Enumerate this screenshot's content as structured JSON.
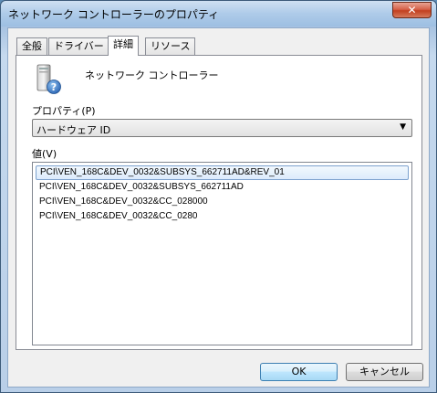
{
  "window": {
    "title": "ネットワーク コントローラーのプロパティ",
    "close_label": "✕"
  },
  "tabs": [
    {
      "label": "全般"
    },
    {
      "label": "ドライバー"
    },
    {
      "label": "詳細"
    },
    {
      "label": "リソース"
    }
  ],
  "device": {
    "name": "ネットワーク コントローラー",
    "icon": "unknown-device-icon"
  },
  "property": {
    "label": "プロパティ(P)",
    "selected": "ハードウェア ID"
  },
  "values": {
    "label": "値(V)",
    "items": [
      "PCI\\VEN_168C&DEV_0032&SUBSYS_662711AD&REV_01",
      "PCI\\VEN_168C&DEV_0032&SUBSYS_662711AD",
      "PCI\\VEN_168C&DEV_0032&CC_028000",
      "PCI\\VEN_168C&DEV_0032&CC_0280"
    ]
  },
  "buttons": {
    "ok": "OK",
    "cancel": "キャンセル"
  }
}
